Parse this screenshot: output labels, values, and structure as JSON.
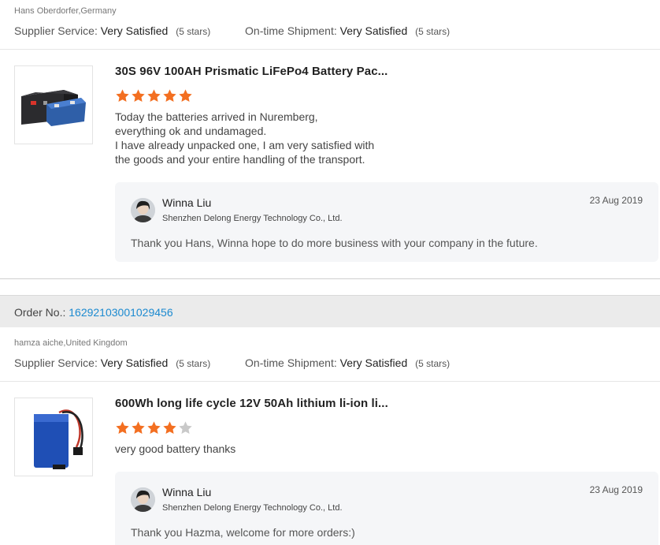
{
  "review1": {
    "reviewer": "Hans Oberdorfer,Germany",
    "supplier_service_label": "Supplier Service:",
    "supplier_service_value": "Very Satisfied",
    "supplier_service_stars": "(5 stars)",
    "shipment_label": "On-time Shipment:",
    "shipment_value": "Very Satisfied",
    "shipment_stars": "(5 stars)",
    "product_title": "30S 96V 100AH Prismatic LiFePo4 Battery Pac...",
    "product_icon": "battery-pack-image",
    "rating": 5,
    "text_lines": [
      "Today the batteries arrived in Nuremberg,",
      "everything ok and undamaged.",
      "I have already unpacked one, I am very satisfied with",
      "the goods and your entire handling of the transport."
    ],
    "reply": {
      "name": "Winna Liu",
      "company": "Shenzhen Delong Energy Technology Co., Ltd.",
      "date": "23 Aug 2019",
      "text": "Thank you Hans,  Winna hope to do more business with your company in the future."
    }
  },
  "order": {
    "label": "Order No.:",
    "number": "16292103001029456"
  },
  "review2": {
    "reviewer": "hamza aiche,United Kingdom",
    "supplier_service_label": "Supplier Service:",
    "supplier_service_value": "Very Satisfied",
    "supplier_service_stars": "(5 stars)",
    "shipment_label": "On-time Shipment:",
    "shipment_value": "Very Satisfied",
    "shipment_stars": "(5 stars)",
    "product_title": "600Wh long life cycle 12V 50Ah lithium li-ion li...",
    "product_icon": "blue-battery-image",
    "rating": 4,
    "text": "very good battery thanks",
    "reply": {
      "name": "Winna Liu",
      "company": "Shenzhen Delong Energy Technology Co., Ltd.",
      "date": "23 Aug 2019",
      "text": "Thank you Hazma, welcome for more orders:)"
    }
  },
  "colors": {
    "star_filled": "#f36f21",
    "star_empty": "#c9c9c9",
    "order_link": "#1c8ad0"
  }
}
